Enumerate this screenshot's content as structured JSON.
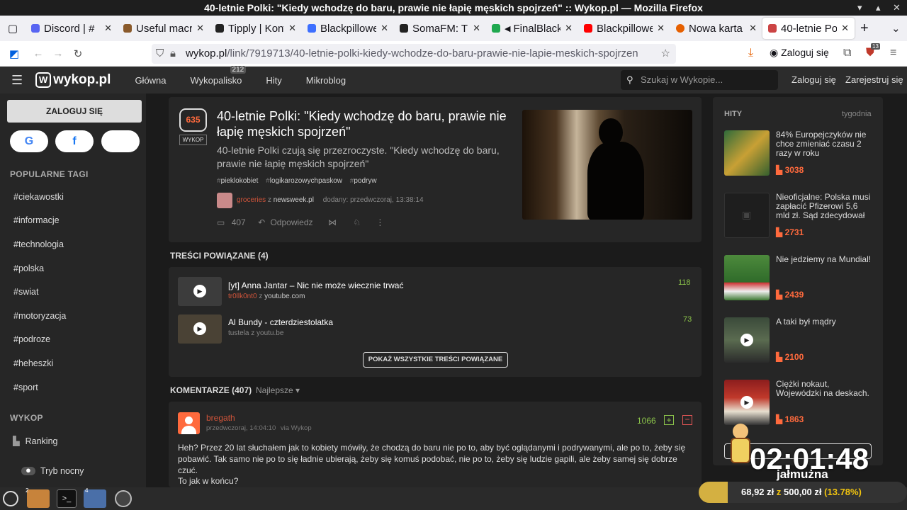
{
  "window": {
    "title": "40-letnie Polki: \"Kiedy wchodzę do baru, prawie nie łapię męskich spojrzeń\" :: Wykop.pl — Mozilla Firefox"
  },
  "tabs": [
    {
      "label": "Discord | #",
      "color": "#5865f2"
    },
    {
      "label": "Useful macro",
      "color": "#8a5a2b"
    },
    {
      "label": "Tipply | Konf",
      "color": "#222222"
    },
    {
      "label": "Blackpillowe",
      "color": "#3d6fff"
    },
    {
      "label": "SomaFM: The",
      "color": "#222222"
    },
    {
      "label": "FinalBlack",
      "color": "#1fa84f"
    },
    {
      "label": "Blackpillowe",
      "color": "#ff0000"
    },
    {
      "label": "Nowa karta",
      "color": "#e66000"
    },
    {
      "label": "40-letnie Poll",
      "color": "#cc4444"
    }
  ],
  "url": {
    "domain": "wykop.pl",
    "path": "/link/7919713/40-letnie-polki-kiedy-wchodze-do-baru-prawie-nie-lapie-meskich-spojrzen"
  },
  "browser": {
    "login_label": "Zaloguj się",
    "ext_badge": "13"
  },
  "header": {
    "logo": "wykop.pl",
    "nav": [
      "Główna",
      "Wykopalisko",
      "Hity",
      "Mikroblog"
    ],
    "wykopalisko_badge": "212",
    "search_placeholder": "Szukaj w Wykopie...",
    "login": "Zaloguj się",
    "register": "Zarejestruj się"
  },
  "sidebar": {
    "login_button": "ZALOGUJ SIĘ",
    "popular_tags_title": "POPULARNE TAGI",
    "tags": [
      "#ciekawostki",
      "#informacje",
      "#technologia",
      "#polska",
      "#swiat",
      "#motoryzacja",
      "#podroze",
      "#heheszki",
      "#sport"
    ],
    "wykop_title": "WYKOP",
    "ranking": "Ranking",
    "night_mode": "Tryb nocny"
  },
  "article": {
    "votes": "635",
    "vote_label": "WYKOP",
    "title": "40-letnie Polki: \"Kiedy wchodzę do baru, prawie nie łapię męskich spojrzeń\"",
    "description": "40-letnie Polki czują się przezroczyste. \"Kiedy wchodzę do baru, prawie nie łapię męskich spojrzeń\"",
    "tags": [
      "pieklokobiet",
      "logikarozowychpaskow",
      "podryw"
    ],
    "author": "groceries",
    "source_prefix": "z",
    "source": "newsweek.pl",
    "added": "dodany: przedwczoraj, 13:38:14",
    "comments_count": "407",
    "reply": "Odpowiedz"
  },
  "related": {
    "title": "TREŚCI POWIĄZANE (4)",
    "items": [
      {
        "title": "[yt] Anna Jantar – Nic nie może wiecznie trwać",
        "author": "tr0llk0nt0",
        "source": "youtube.com",
        "votes": "118"
      },
      {
        "title": "Al Bundy - czterdziestolatka",
        "author": "tustela",
        "source": "youtu.be",
        "votes": "73"
      }
    ],
    "show_all": "POKAŻ WSZYSTKIE TREŚCI POWIĄZANE"
  },
  "comments": {
    "title": "KOMENTARZE (407)",
    "sort": "Najlepsze",
    "first": {
      "author": "bregath",
      "date": "przedwczoraj, 14:04:10",
      "via": "via Wykop",
      "votes": "1066",
      "text": "Heh? Przez 20 lat słuchałem jak to kobiety mówiły, że chodzą do baru nie po to, aby być oglądanymi i podrywanymi, ale po to, żeby się pobawić. Tak samo nie po to się ładnie ubierają, żeby się komuś podobać, nie po to, żeby się ludzie gapili, ale żeby samej się dobrze czuć.",
      "text2": "To jak w końcu?"
    }
  },
  "hits": {
    "title": "HITY",
    "period": "tygodnia",
    "items": [
      {
        "title": "84% Europejczyków nie chce zmieniać czasu 2 razy w roku",
        "votes": "3038"
      },
      {
        "title": "Nieoficjalne: Polska musi zapłacić Pfizerowi 5,6 mld zł. Sąd zdecydował",
        "votes": "2731"
      },
      {
        "title": "Nie jedziemy na Mundial!",
        "votes": "2439"
      },
      {
        "title": "A taki był mądry",
        "votes": "2100"
      },
      {
        "title": "Ciężki nokaut, Wojewódzki na deskach.",
        "votes": "1863"
      }
    ]
  },
  "overlay": {
    "timer": "02:01:48",
    "label": "jałmużna",
    "donate_current": "68,92 zł",
    "donate_sep": "z",
    "donate_goal": "500,00 zł",
    "donate_pct": "(13.78%)",
    "donate_fraction": 0.1378
  },
  "taskbar": {
    "badge_files": "2",
    "badge_firefox": "4"
  }
}
